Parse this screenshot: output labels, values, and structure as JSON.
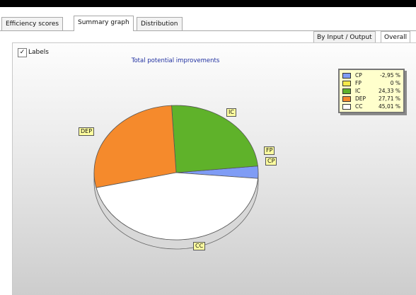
{
  "tabs": [
    {
      "label": "Efficiency scores",
      "active": false
    },
    {
      "label": "Summary graph",
      "active": true
    },
    {
      "label": "Distribution",
      "active": false
    }
  ],
  "subtabs": [
    {
      "label": "By Input / Output",
      "active": false
    },
    {
      "label": "Overall",
      "active": true
    }
  ],
  "labels_checkbox": {
    "label": "Labels",
    "checked": true
  },
  "chart_data": {
    "type": "pie",
    "title": "Total potential improvements",
    "legend_placement": "top-right",
    "slices": [
      {
        "code": "CP",
        "value": -2.95,
        "display": "-2,95 %",
        "color": "#7f9cf5"
      },
      {
        "code": "FP",
        "value": 0,
        "display": "0 %",
        "color": "#f5e94a"
      },
      {
        "code": "IC",
        "value": 24.33,
        "display": "24,33 %",
        "color": "#5fb22a"
      },
      {
        "code": "DEP",
        "value": 27.71,
        "display": "27,71 %",
        "color": "#f58a2c"
      },
      {
        "code": "CC",
        "value": 45.01,
        "display": "45,01 %",
        "color": "#ffffff"
      }
    ]
  }
}
